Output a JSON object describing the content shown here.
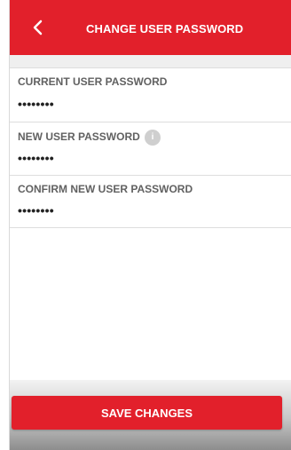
{
  "header": {
    "title": "CHANGE USER PASSWORD",
    "back_icon": "chevron-left-icon",
    "background_color": "#e2202b"
  },
  "form": {
    "current_password": {
      "label": "CURRENT USER PASSWORD",
      "value": "••••••••"
    },
    "new_password": {
      "label": "NEW USER PASSWORD",
      "value": "••••••••",
      "info_icon": "info-icon",
      "info_glyph": "i"
    },
    "confirm_password": {
      "label": "CONFIRM NEW USER PASSWORD",
      "value": "••••••••"
    }
  },
  "footer": {
    "save_label": "SAVE CHANGES",
    "button_color": "#e2202b"
  }
}
